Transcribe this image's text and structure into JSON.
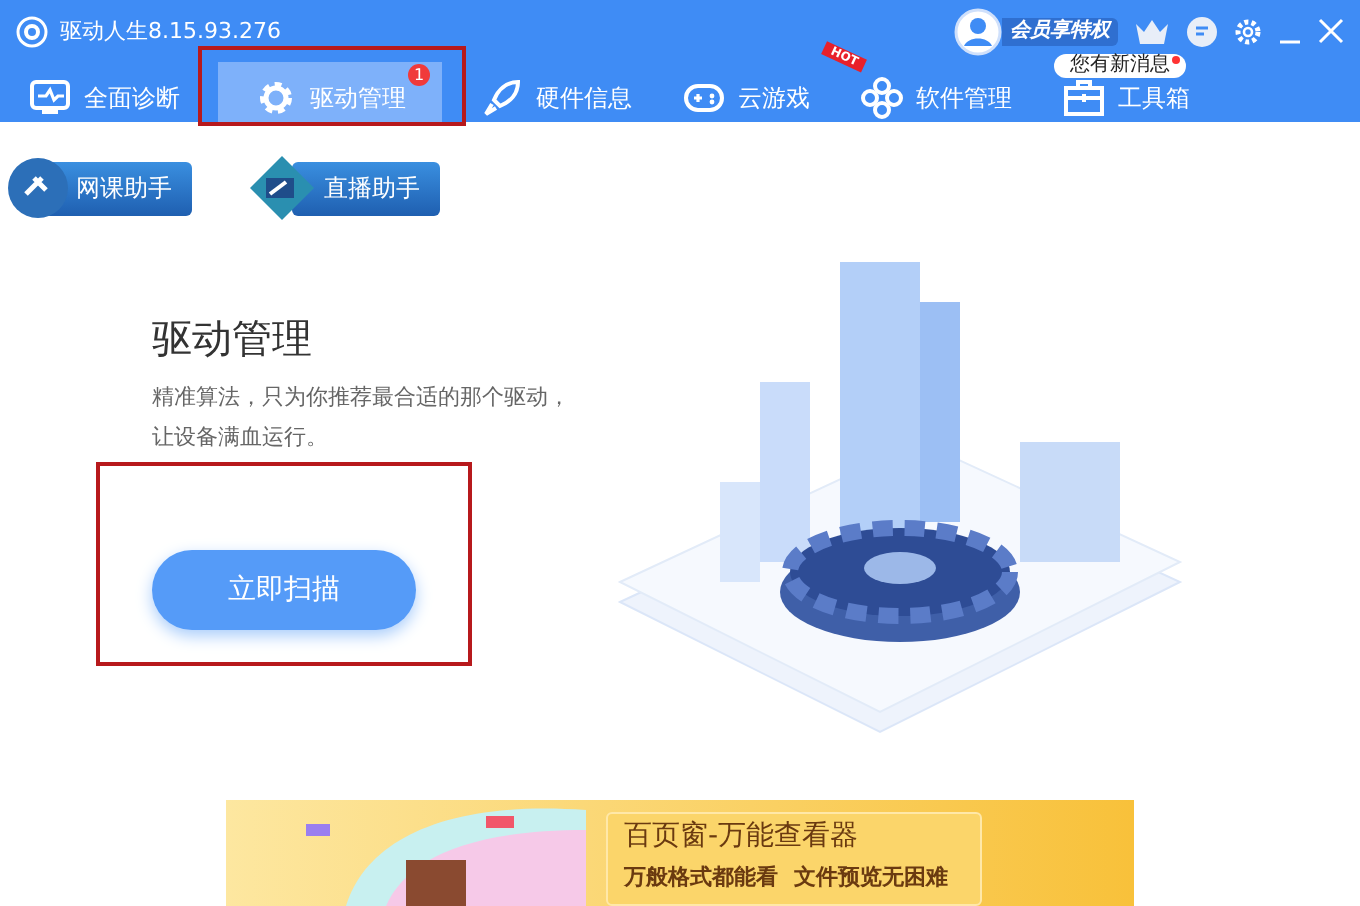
{
  "window": {
    "title": "驱动人生8.15.93.276"
  },
  "account": {
    "vip_label": "会员享特权",
    "message_tip": "您有新消息",
    "has_new_message": true
  },
  "tabs": [
    {
      "label": "全面诊断",
      "selected": false,
      "highlighted": false
    },
    {
      "label": "驱动管理",
      "selected": true,
      "highlighted": true,
      "badge": "1"
    },
    {
      "label": "硬件信息",
      "selected": false,
      "highlighted": false
    },
    {
      "label": "云游戏",
      "selected": false,
      "highlighted": false,
      "ribbon": "HOT"
    },
    {
      "label": "软件管理",
      "selected": false,
      "highlighted": false
    },
    {
      "label": "工具箱",
      "selected": false,
      "highlighted": false
    }
  ],
  "helpers": [
    {
      "label": "网课助手"
    },
    {
      "label": "直播助手"
    }
  ],
  "feature": {
    "title": "驱动管理",
    "description": "精准算法，只为你推荐最合适的那个驱动，让设备满血运行。",
    "scan_button": "立即扫描",
    "highlighted": true
  },
  "banner": {
    "title": "百页窗-万能查看器",
    "lines": [
      "万般格式都能看",
      "文件预览无困难"
    ]
  }
}
